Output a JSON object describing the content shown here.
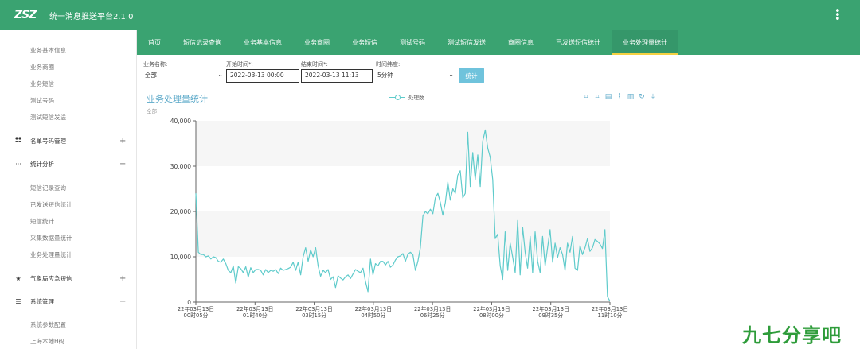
{
  "header": {
    "logo": "ZSZ",
    "title": "统一消息推送平台2.1.0",
    "more_icon": "kebab-icon"
  },
  "sidebar": {
    "items_top": [
      "业务基本信息",
      "业务商圈",
      "业务短信",
      "测试号码",
      "测试短信发送"
    ],
    "group_blacklist": {
      "icon": "users-icon",
      "label": "名单号码管理",
      "toggle": "+"
    },
    "group_stats": {
      "icon": "ellipsis-icon",
      "label": "统计分析",
      "toggle": "−"
    },
    "items_stats": [
      "短信记录查询",
      "已发送短信统计",
      "短信统计",
      "采集数据量统计",
      "业务处理量统计"
    ],
    "group_weather": {
      "icon": "star-icon",
      "label": "气象局应急短信",
      "toggle": "+"
    },
    "group_system": {
      "icon": "menu-icon",
      "label": "系统管理",
      "toggle": "−"
    },
    "items_system": [
      "系统参数配置",
      "上海本地H码"
    ]
  },
  "tabs": [
    "首页",
    "短信记录查询",
    "业务基本信息",
    "业务商圈",
    "业务短信",
    "测试号码",
    "测试短信发送",
    "商圈信息",
    "已发送短信统计",
    "业务处理量统计"
  ],
  "active_tab": 9,
  "filters": {
    "business_label": "业务名称:",
    "business_value": "全部",
    "start_label": "开始时间*:",
    "start_value": "2022-03-13 00:00",
    "end_label": "结束时间*:",
    "end_value": "2022-03-13 11:13",
    "dim_label": "时间纬度:",
    "dim_value": "5分钟",
    "stat_button": "统计"
  },
  "colors": {
    "primary": "#3aa371",
    "line": "#5fcbcb",
    "title": "#5aa8c8",
    "button": "#6fc3dc"
  },
  "toolbox_icons": [
    "zoom-icon",
    "zoom-reset-icon",
    "data-view-icon",
    "line-icon",
    "bar-icon",
    "restore-icon",
    "download-icon"
  ],
  "watermark": "九七分享吧",
  "chart_data": {
    "type": "line",
    "title": "业务处理量统计",
    "subtitle": "全部",
    "legend": [
      "处理数"
    ],
    "legend_position": "top-center",
    "ylim": [
      0,
      40000
    ],
    "y_ticks": [
      "0",
      "10,000",
      "20,000",
      "30,000",
      "40,000"
    ],
    "x_ticks": [
      "22年03月13日\n00时05分",
      "22年03月13日\n01时40分",
      "22年03月13日\n03时15分",
      "22年03月13日\n04时50分",
      "22年03月13日\n06时25分",
      "22年03月13日\n08时00分",
      "22年03月13日\n09时35分",
      "22年03月13日\n11时10分"
    ],
    "grid": true,
    "series": [
      {
        "name": "处理数",
        "values": [
          24000,
          11000,
          10500,
          10500,
          10000,
          10200,
          9500,
          10000,
          9800,
          9000,
          8800,
          9500,
          8500,
          7000,
          6500,
          8000,
          4200,
          7800,
          7400,
          6500,
          7800,
          5500,
          7600,
          6500,
          7200,
          7200,
          7000,
          6000,
          7200,
          6500,
          7000,
          6800,
          7200,
          6300,
          7500,
          7000,
          7200,
          7400,
          7700,
          8800,
          7000,
          8800,
          6000,
          10000,
          12000,
          9000,
          11500,
          10000,
          12000,
          8000,
          5700,
          7000,
          6500,
          7200,
          5000,
          5600,
          3200,
          5800,
          5300,
          4900,
          5600,
          6000,
          5200,
          6200,
          7200,
          6800,
          6500,
          7500,
          4500,
          2300,
          9500,
          6000,
          8500,
          8000,
          9000,
          9000,
          8200,
          9000,
          7700,
          8200,
          9300,
          10000,
          10200,
          10700,
          9000,
          10600,
          11000,
          10500,
          7000,
          9000,
          12000,
          19000,
          20000,
          19500,
          20500,
          19500,
          23000,
          24000,
          22000,
          19200,
          22000,
          26500,
          22500,
          25000,
          24000,
          28000,
          29000,
          23000,
          24000,
          37500,
          25500,
          33000,
          27000,
          32500,
          25500,
          35500,
          38000,
          34000,
          32000,
          27000,
          14000,
          15000,
          8000,
          5000,
          15500,
          7000,
          13000,
          10000,
          6500,
          18000,
          6000,
          16500,
          11000,
          7500,
          14500,
          6500,
          15500,
          9000,
          6500,
          14500,
          8000,
          12000,
          16000,
          8800,
          13000,
          9800,
          12000,
          10500,
          7000,
          13000,
          11000,
          14500,
          7500,
          7000,
          12500,
          10500,
          12000,
          14000,
          11200,
          12000,
          13800,
          13400,
          12800,
          11800,
          16000,
          1200,
          200
        ]
      }
    ]
  }
}
